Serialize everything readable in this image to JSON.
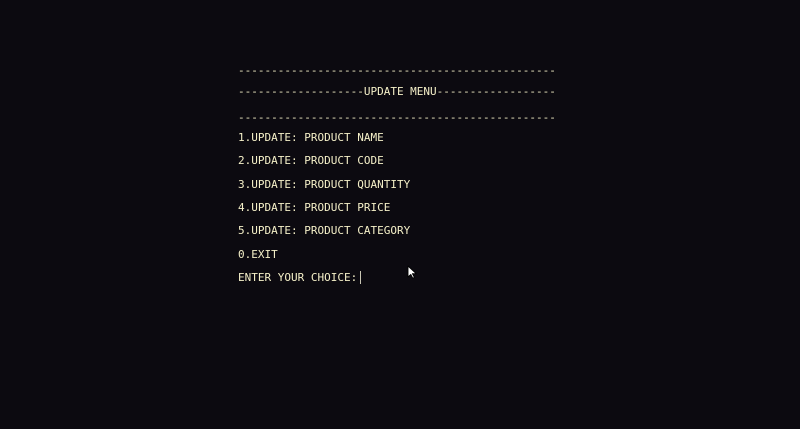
{
  "console": {
    "rule_top": "------------------------------------------------",
    "menu_title": "-------------------UPDATE MENU------------------",
    "rule_bottom": "------------------------------------------------",
    "options": [
      "1.UPDATE: PRODUCT NAME",
      "2.UPDATE: PRODUCT CODE",
      "3.UPDATE: PRODUCT QUANTITY",
      "4.UPDATE: PRODUCT PRICE",
      "5.UPDATE: PRODUCT CATEGORY",
      "0.EXIT"
    ],
    "prompt": "ENTER YOUR CHOICE:",
    "input_value": ""
  },
  "colors": {
    "background": "#0c0a10",
    "text": "#f5f0c8"
  },
  "icons": {
    "cursor": "mouse-pointer-icon",
    "caret": "text-caret"
  }
}
